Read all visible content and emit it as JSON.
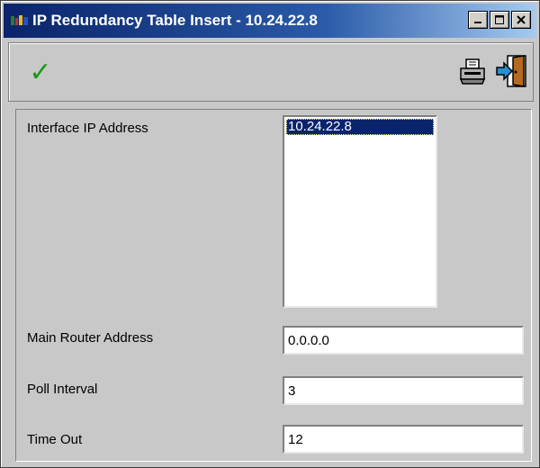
{
  "window": {
    "title": "IP Redundancy Table Insert - 10.24.22.8"
  },
  "titlebar_buttons": {
    "minimize": "_",
    "maximize": "□",
    "close": "✕"
  },
  "toolbar": {
    "ok_icon": "checkmark-icon",
    "ok_glyph": "✓",
    "print_icon": "printer-icon",
    "exit_icon": "exit-door-icon"
  },
  "form": {
    "interface_ip": {
      "label": "Interface IP Address",
      "options": [
        "10.24.22.8"
      ],
      "selected": "10.24.22.8"
    },
    "main_router": {
      "label": "Main Router Address",
      "value": "0.0.0.0"
    },
    "poll_interval": {
      "label": "Poll Interval",
      "value": "3"
    },
    "time_out": {
      "label": "Time Out",
      "value": "12"
    }
  },
  "colors": {
    "title_gradient_start": "#0a246a",
    "title_gradient_end": "#a6caf0",
    "window_bg": "#c8c8c8",
    "selection_bg": "#0a246a",
    "check_green": "#1a9a1a"
  }
}
